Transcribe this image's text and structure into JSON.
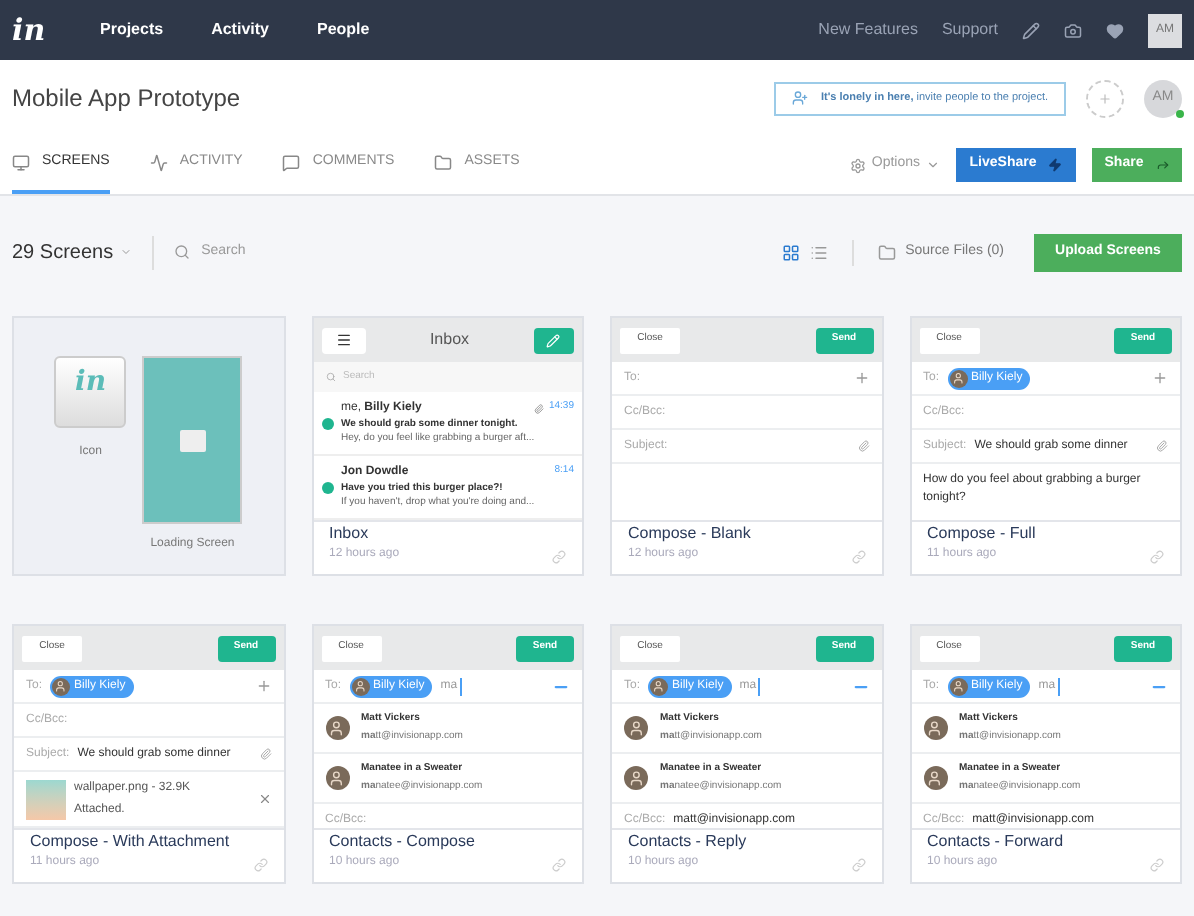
{
  "nav": {
    "logo": "in",
    "links": [
      {
        "label": "Projects",
        "selected": false
      },
      {
        "label": "Activity",
        "selected": false
      },
      {
        "label": "People",
        "selected": false
      }
    ],
    "right_links": [
      "New Features",
      "Support"
    ],
    "avatar": "AM"
  },
  "header": {
    "title": "Mobile App Prototype",
    "invite": "**It's lonely in here,** invite people to the project.",
    "avatar": "AM",
    "online": true
  },
  "tabs": [
    {
      "label": "SCREENS",
      "selected": true
    },
    {
      "label": "ACTIVITY",
      "selected": false
    },
    {
      "label": "COMMENTS",
      "selected": false
    },
    {
      "label": "ASSETS",
      "selected": false
    }
  ],
  "actions": {
    "options": "Options",
    "liveshare": "LiveShare",
    "share": "Share"
  },
  "toolbar": {
    "count": "29 Screens",
    "search_placeholder": "Search",
    "view_modes": [
      {
        "kind": "grid",
        "selected": true
      },
      {
        "kind": "list",
        "selected": false
      }
    ],
    "source_files": "Source Files (0)",
    "upload": "Upload Screens"
  },
  "screens": [
    {
      "kind": "assets",
      "items": [
        {
          "kind": "icon",
          "logo": "in",
          "label": "Icon"
        },
        {
          "kind": "splash",
          "label": "Loading Screen"
        }
      ]
    },
    {
      "kind": "inbox",
      "header": "Inbox",
      "search_placeholder": "Search",
      "messages": [
        {
          "from_prefix": "me, ",
          "from": "Billy Kiely",
          "time": "14:39",
          "attachment": true,
          "subject": "We should grab some dinner tonight.",
          "preview": "Hey, do you feel like grabbing a burger aft..."
        },
        {
          "from": "Jon Dowdle",
          "time": "8:14",
          "attachment": false,
          "subject": "Have you tried this burger place?!",
          "preview": "If you haven't, drop what you're doing and..."
        }
      ],
      "name": "Inbox",
      "time": "12 hours ago"
    },
    {
      "kind": "compose",
      "close": "Close",
      "send": "Send",
      "rows": [
        {
          "kind": "to",
          "label": "To:",
          "expanded": false
        },
        {
          "kind": "field",
          "label": "Cc/Bcc:",
          "clip": false
        },
        {
          "kind": "field",
          "label": "Subject:",
          "clip": true
        }
      ],
      "name": "Compose - Blank",
      "time": "12 hours ago"
    },
    {
      "kind": "compose",
      "close": "Close",
      "send": "Send",
      "rows": [
        {
          "kind": "to",
          "label": "To:",
          "chip": "Billy Kiely",
          "expanded": false
        },
        {
          "kind": "field",
          "label": "Cc/Bcc:",
          "clip": false
        },
        {
          "kind": "field",
          "label": "Subject:",
          "value": "We should grab some dinner",
          "clip": true
        },
        {
          "kind": "body",
          "text": "How do you feel about grabbing a burger tonight?"
        }
      ],
      "name": "Compose - Full",
      "time": "11 hours ago"
    },
    {
      "kind": "compose",
      "close": "Close",
      "send": "Send",
      "rows": [
        {
          "kind": "to",
          "label": "To:",
          "chip": "Billy Kiely",
          "expanded": false
        },
        {
          "kind": "field",
          "label": "Cc/Bcc:",
          "clip": false
        },
        {
          "kind": "field",
          "label": "Subject:",
          "value": "We should grab some dinner",
          "clip": true
        },
        {
          "kind": "attachment",
          "filename": "wallpaper.png - 32.9K",
          "status": "Attached."
        }
      ],
      "name": "Compose - With Attachment",
      "time": "11 hours ago"
    },
    {
      "kind": "compose",
      "close": "Close",
      "send": "Send",
      "rows": [
        {
          "kind": "to",
          "label": "To:",
          "chip": "Billy Kiely",
          "typed": "ma",
          "expanded": true
        },
        {
          "kind": "contact",
          "name": "Matt Vickers",
          "email": "**ma**tt@invisionapp.com"
        },
        {
          "kind": "contact",
          "name": "Manatee in a Sweater",
          "email": "**ma**natee@invisionapp.com"
        },
        {
          "kind": "field",
          "label": "Cc/Bcc:",
          "clip": false
        }
      ],
      "name": "Contacts - Compose",
      "time": "10 hours ago"
    },
    {
      "kind": "compose",
      "close": "Close",
      "send": "Send",
      "rows": [
        {
          "kind": "to",
          "label": "To:",
          "chip": "Billy Kiely",
          "typed": "ma",
          "expanded": true
        },
        {
          "kind": "contact",
          "name": "Matt Vickers",
          "email": "**ma**tt@invisionapp.com"
        },
        {
          "kind": "contact",
          "name": "Manatee in a Sweater",
          "email": "**ma**natee@invisionapp.com"
        },
        {
          "kind": "field",
          "label": "Cc/Bcc:",
          "value": "matt@invisionapp.com",
          "clip": false
        }
      ],
      "name": "Contacts - Reply",
      "time": "10 hours ago"
    },
    {
      "kind": "compose",
      "close": "Close",
      "send": "Send",
      "rows": [
        {
          "kind": "to",
          "label": "To:",
          "chip": "Billy Kiely",
          "typed": "ma",
          "expanded": true
        },
        {
          "kind": "contact",
          "name": "Matt Vickers",
          "email": "**ma**tt@invisionapp.com"
        },
        {
          "kind": "contact",
          "name": "Manatee in a Sweater",
          "email": "**ma**natee@invisionapp.com"
        },
        {
          "kind": "field",
          "label": "Cc/Bcc:",
          "value": "matt@invisionapp.com",
          "clip": false
        }
      ],
      "name": "Contacts - Forward",
      "time": "10 hours ago"
    }
  ]
}
